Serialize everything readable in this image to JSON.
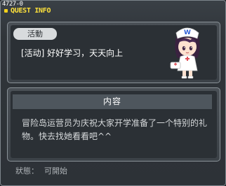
{
  "window": {
    "quest_id": "4727-0",
    "title": "QUEST INFO"
  },
  "quest": {
    "category": "活動",
    "name": "[活动] 好好学习，天天向上"
  },
  "npc": {
    "icon": "npc-nurse-avatar-icon",
    "hat_letter": "W"
  },
  "content": {
    "header": "内容",
    "body": "冒险岛运营员为庆祝大家开学准备了一个特别的礼物。快去找她看看吧^^"
  },
  "status": {
    "label": "狀態：",
    "value": "可開始"
  },
  "colors": {
    "title": "#ffe23b",
    "panel_bg": "#2b3035",
    "pill_bg": "#d8dbdd"
  }
}
